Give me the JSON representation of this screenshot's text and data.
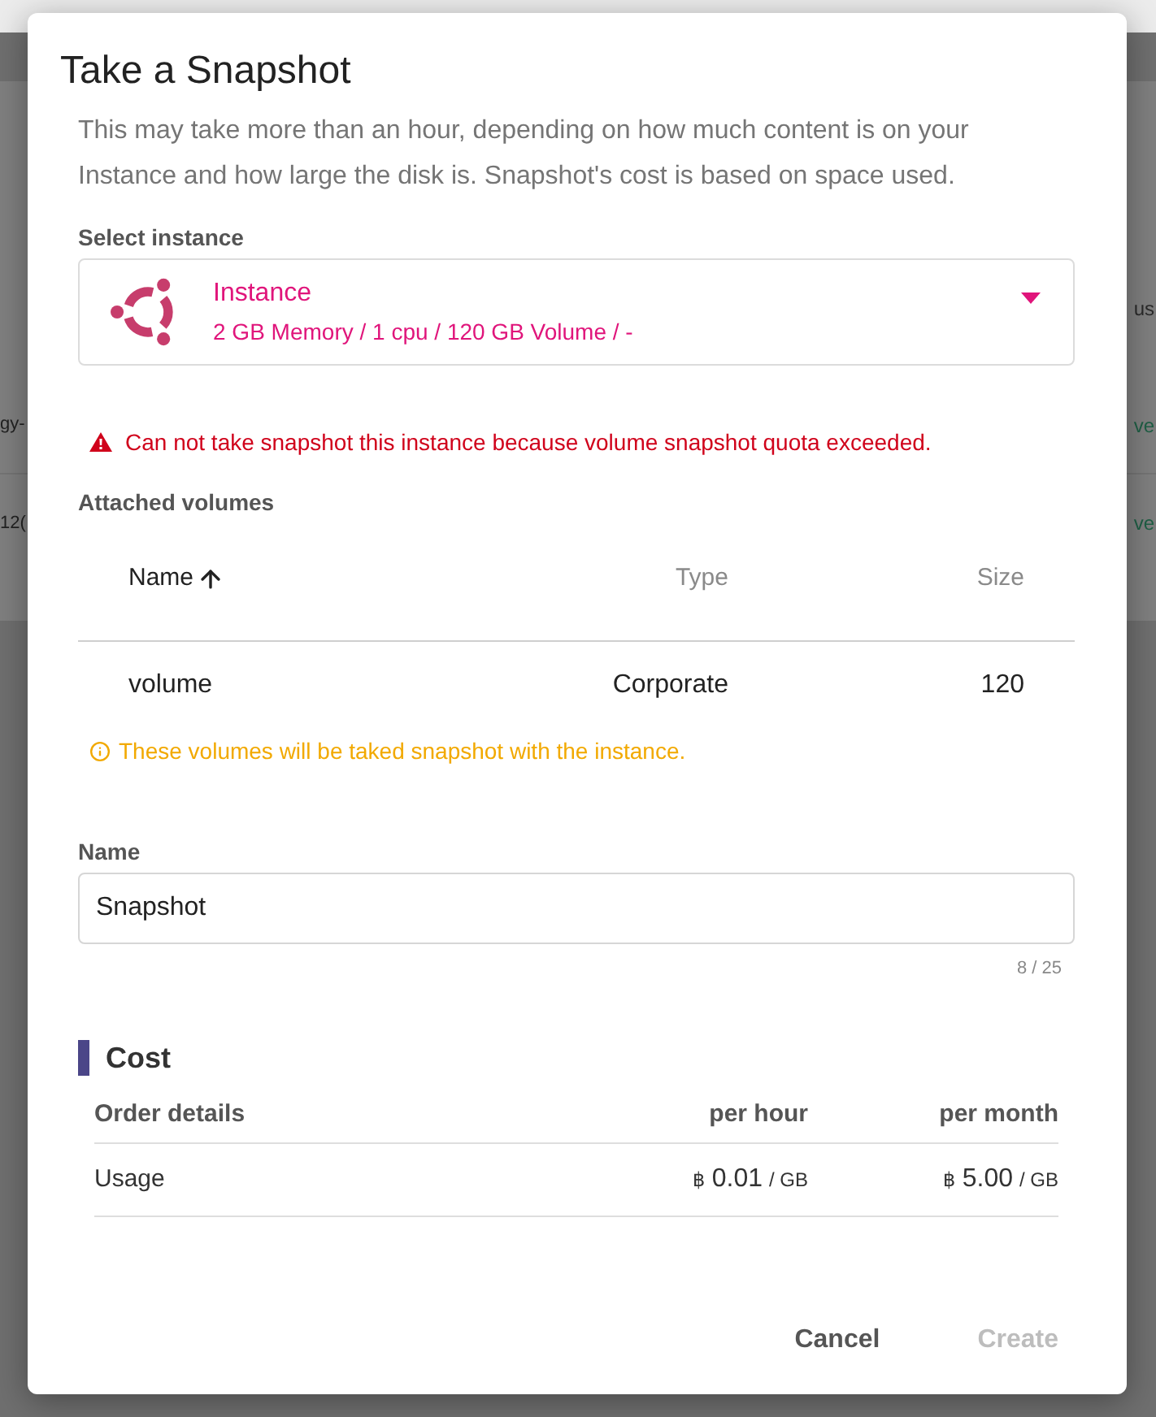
{
  "background": {
    "header_fragment": "us",
    "rows": [
      {
        "left": "gy-",
        "right": "ve"
      },
      {
        "left": "12(",
        "right": "ve"
      }
    ]
  },
  "dialog": {
    "title": "Take a Snapshot",
    "description": "This may take more than an hour, depending on how much content is on your Instance and how large the disk is. Snapshot's cost is based on space used.",
    "instance_select": {
      "label": "Select instance",
      "title": "Instance",
      "detail": "2 GB Memory / 1 cpu / 120 GB Volume / -"
    },
    "error_message": "Can not take snapshot this instance because volume snapshot quota exceeded.",
    "volumes": {
      "label": "Attached volumes",
      "columns": [
        {
          "label": "Name",
          "sorted": true
        },
        {
          "label": "Type",
          "sorted": false
        },
        {
          "label": "Size",
          "sorted": false
        }
      ],
      "rows": [
        [
          "volume",
          "Corporate",
          "120"
        ]
      ],
      "note": "These volumes will be taked snapshot with the instance."
    },
    "name_field": {
      "label": "Name",
      "value": "Snapshot",
      "counter": "8 / 25"
    },
    "cost": {
      "title": "Cost",
      "columns": [
        "Order details",
        "per hour",
        "per month"
      ],
      "rows": [
        {
          "label": "Usage",
          "prices": [
            {
              "currency": "฿",
              "amount": "0.01",
              "unit": "/ GB"
            },
            {
              "currency": "฿",
              "amount": "5.00",
              "unit": "/ GB"
            }
          ]
        }
      ]
    },
    "buttons": [
      {
        "label": "Cancel",
        "disabled": false
      },
      {
        "label": "Create",
        "disabled": true
      }
    ]
  }
}
